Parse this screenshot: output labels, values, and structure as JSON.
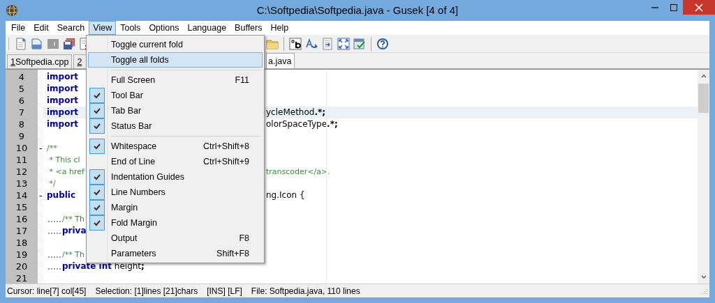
{
  "window": {
    "title": "C:\\Softpedia\\Softpedia.java - Gusek [4 of 4]"
  },
  "menu_bar": [
    {
      "label": "File",
      "selected": false
    },
    {
      "label": "Edit",
      "selected": false
    },
    {
      "label": "Search",
      "selected": false
    },
    {
      "label": "View",
      "selected": true
    },
    {
      "label": "Tools",
      "selected": false
    },
    {
      "label": "Options",
      "selected": false
    },
    {
      "label": "Language",
      "selected": false
    },
    {
      "label": "Buffers",
      "selected": false
    },
    {
      "label": "Help",
      "selected": false
    }
  ],
  "toolbar_left": [
    {
      "kind": "new"
    },
    {
      "kind": "open"
    },
    {
      "kind": "number"
    },
    {
      "kind": "save-all"
    },
    {
      "kind": "close-doc"
    }
  ],
  "toolbar_right": [
    {
      "kind": "folder"
    },
    {
      "kind": "separator"
    },
    {
      "kind": "ab"
    },
    {
      "kind": "replace"
    },
    {
      "kind": "goto"
    },
    {
      "kind": "fullscreen"
    },
    {
      "kind": "checklist"
    },
    {
      "kind": "separator"
    },
    {
      "kind": "help"
    }
  ],
  "tabs": [
    {
      "number": "1",
      "label": "Softpedia.cpp",
      "selected": false
    },
    {
      "number": "2",
      "selected": false
    },
    {
      "label": "a.java",
      "selected": true
    }
  ],
  "code_lines": [
    {
      "number": "4",
      "current": false,
      "left": [
        {
          "kind": "keyword",
          "text": "import"
        }
      ]
    },
    {
      "number": "5",
      "current": false,
      "left": [
        {
          "kind": "keyword",
          "text": "import"
        }
      ]
    },
    {
      "number": "6",
      "current": false,
      "left": [
        {
          "kind": "keyword",
          "text": "import"
        }
      ]
    },
    {
      "number": "7",
      "current": true,
      "left": [
        {
          "kind": "keyword",
          "text": "import"
        }
      ],
      "right": [
        {
          "kind": "plain",
          "text": "ycleMethod"
        },
        {
          "kind": "operator",
          "text": ".*;"
        }
      ]
    },
    {
      "number": "8",
      "current": false,
      "left": [
        {
          "kind": "keyword",
          "text": "import"
        }
      ],
      "right": [
        {
          "kind": "plain",
          "text": "olorSpaceType"
        },
        {
          "kind": "operator",
          "text": ".*;"
        }
      ]
    },
    {
      "number": "9",
      "current": false
    },
    {
      "number": "10",
      "current": false,
      "fold": "-",
      "left": [
        {
          "kind": "comment",
          "text": "/**"
        }
      ]
    },
    {
      "number": "11",
      "current": false,
      "left": [
        {
          "kind": "comment",
          "text": " * This cl"
        }
      ]
    },
    {
      "number": "12",
      "current": false,
      "left": [
        {
          "kind": "comment",
          "text": " * <a href"
        }
      ],
      "right": [
        {
          "kind": "comment",
          "text": "transcoder</a>."
        }
      ]
    },
    {
      "number": "13",
      "current": false,
      "left": [
        {
          "kind": "comment",
          "text": " */"
        }
      ]
    },
    {
      "number": "14",
      "current": false,
      "fold": "-",
      "left": [
        {
          "kind": "keyword",
          "text": "public"
        }
      ],
      "right": [
        {
          "kind": "plain",
          "text": "ng.Icon {"
        }
      ]
    },
    {
      "number": "15",
      "current": false
    },
    {
      "number": "16",
      "current": false,
      "indented": true,
      "left": [
        {
          "kind": "comment",
          "text": "/** Th"
        }
      ]
    },
    {
      "number": "17",
      "current": false,
      "indented": true,
      "left": [
        {
          "kind": "keyword",
          "text": "priva"
        }
      ]
    },
    {
      "number": "18",
      "current": false
    },
    {
      "number": "19",
      "current": false,
      "indented": true,
      "left": [
        {
          "kind": "comment",
          "text": "/** Th"
        }
      ]
    },
    {
      "number": "20",
      "current": false,
      "indented": true,
      "left": [
        {
          "kind": "keyword",
          "text": "private int"
        },
        {
          "kind": "plain",
          "text": " height"
        },
        {
          "kind": "operator",
          "text": ";"
        }
      ]
    },
    {
      "number": "21",
      "current": false
    }
  ],
  "view_menu": [
    {
      "kind": "command",
      "label": "Toggle current fold",
      "checked": false,
      "selected": false
    },
    {
      "kind": "command",
      "label": "Toggle all folds",
      "checked": false,
      "selected": true
    },
    {
      "kind": "separator"
    },
    {
      "kind": "command",
      "label": "Full Screen",
      "shortcut": "F11",
      "checked": false,
      "selected": false
    },
    {
      "kind": "command",
      "label": "Tool Bar",
      "checked": true,
      "selected": false
    },
    {
      "kind": "command",
      "label": "Tab Bar",
      "checked": true,
      "selected": false
    },
    {
      "kind": "command",
      "label": "Status Bar",
      "checked": true,
      "selected": false
    },
    {
      "kind": "separator"
    },
    {
      "kind": "command",
      "label": "Whitespace",
      "shortcut": "Ctrl+Shift+8",
      "checked": true,
      "selected": false
    },
    {
      "kind": "command",
      "label": "End of Line",
      "shortcut": "Ctrl+Shift+9",
      "checked": false,
      "selected": false
    },
    {
      "kind": "command",
      "label": "Indentation Guides",
      "checked": true,
      "selected": false
    },
    {
      "kind": "command",
      "label": "Line Numbers",
      "checked": true,
      "selected": false
    },
    {
      "kind": "command",
      "label": "Margin",
      "checked": true,
      "selected": false
    },
    {
      "kind": "command",
      "label": "Fold Margin",
      "checked": true,
      "selected": false
    },
    {
      "kind": "command",
      "label": "Output",
      "shortcut": "F8",
      "checked": false,
      "selected": false
    },
    {
      "kind": "command",
      "label": "Parameters",
      "shortcut": "Shift+F8",
      "checked": false,
      "selected": false
    }
  ],
  "status_bar": [
    "Cursor: line[7] col[45]",
    "Selection: [1]lines [21]chars",
    "[INS] [LF]",
    "File: Softpedia.java, 110 lines"
  ]
}
